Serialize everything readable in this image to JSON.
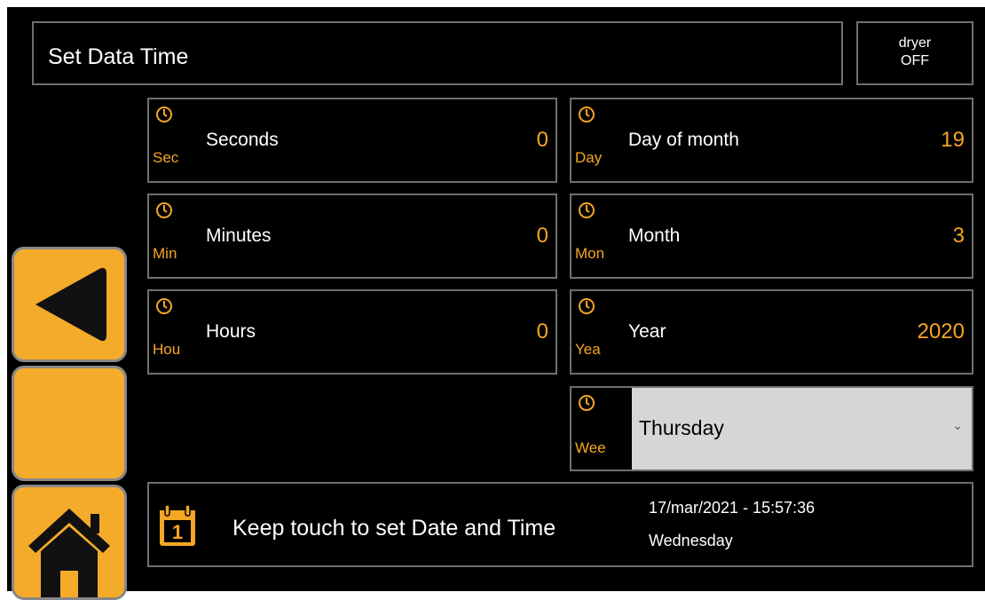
{
  "header": {
    "title": "Set Data Time",
    "dryer_line1": "dryer",
    "dryer_line2": "OFF"
  },
  "fields": [
    {
      "abbr": "Sec",
      "label": "Seconds",
      "value": "0"
    },
    {
      "abbr": "Min",
      "label": "Minutes",
      "value": "0"
    },
    {
      "abbr": "Hou",
      "label": "Hours",
      "value": "0"
    },
    {
      "abbr": "Day",
      "label": "Day of month",
      "value": "19"
    },
    {
      "abbr": "Mon",
      "label": "Month",
      "value": "3"
    },
    {
      "abbr": "Yea",
      "label": "Year",
      "value": "2020"
    }
  ],
  "weekday": {
    "abbr": "Wee",
    "selected": "Thursday"
  },
  "status_bar": {
    "message": "Keep touch to set Date and Time",
    "datetime": "17/mar/2021 - 15:57:36",
    "day_name": "Wednesday",
    "calendar_digit": "1"
  },
  "nav": {
    "back_icon": "triangle-left-icon",
    "home_icon": "home-icon"
  },
  "colors": {
    "accent": "#f5a623",
    "background": "#000000",
    "border": "#6f6f6f",
    "button": "#f5ab2a"
  }
}
